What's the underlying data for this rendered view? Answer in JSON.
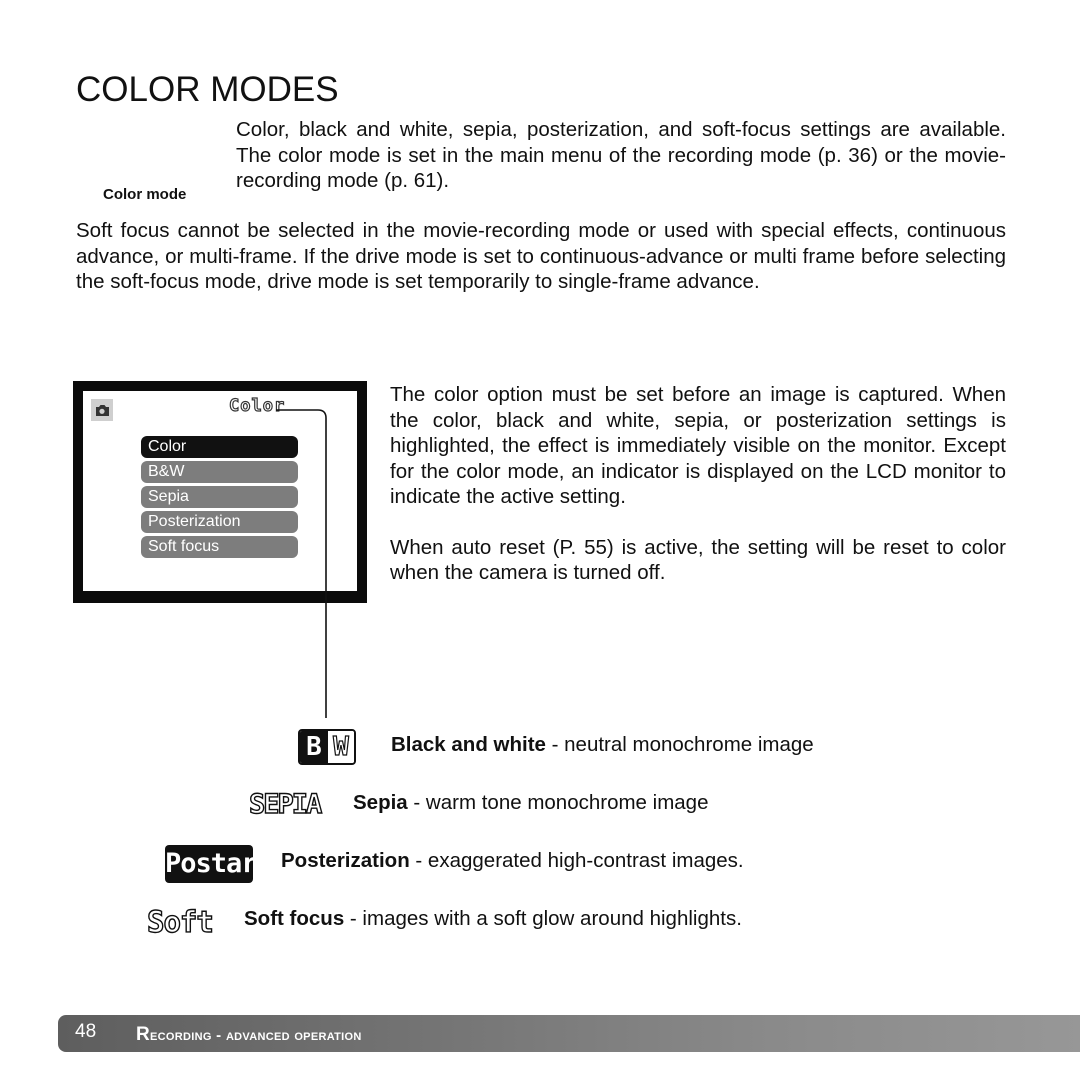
{
  "page": {
    "title": "COLOR MODES",
    "intro": "Color, black and white, sepia, posterization, and soft-focus settings are available. The color mode is set in the main menu of the recording mode (p. 36) or the movie-recording mode (p. 61).",
    "icon_caption": "Color mode",
    "soft_focus_note": "Soft focus cannot be selected in the movie-recording mode or used with special effects, continuous advance, or multi-frame. If the drive mode is set to continuous-advance or multi frame before selecting the soft-focus mode, drive mode is set temporarily to single-frame advance.",
    "right_paragraphs": [
      "The color option must be set before an image is captured. When the color, black and white, sepia, or posterization settings is highlighted, the effect is immediately visible on the monitor. Except for the color mode, an indicator is displayed on the LCD monitor to indicate the active setting.",
      "When auto reset (P. 55) is active, the setting will be reset to color when the camera is turned off."
    ]
  },
  "lcd": {
    "mode_icon": "camera-icon",
    "mode_label": "Color",
    "menu_items": [
      {
        "label": "Color",
        "selected": true
      },
      {
        "label": "B&W",
        "selected": false
      },
      {
        "label": "Sepia",
        "selected": false
      },
      {
        "label": "Posterization",
        "selected": false
      },
      {
        "label": "Soft focus",
        "selected": false
      }
    ]
  },
  "indicators": [
    {
      "badge_left": "B",
      "badge_right": "W",
      "name": "Black and white",
      "description": " - neutral monochrome image"
    },
    {
      "badge": "SEPIA",
      "name": "Sepia",
      "description": " - warm tone monochrome image"
    },
    {
      "badge": "Postar",
      "name": "Posterization",
      "description": " - exaggerated high-contrast images."
    },
    {
      "badge": "Soft",
      "name": "Soft focus",
      "description": " - images with a soft glow around highlights."
    }
  ],
  "footer": {
    "page_number": "48",
    "section_first": "R",
    "section_rest": "ecording - advanced operation"
  },
  "colors": {
    "text": "#111111",
    "menu_selected": "#111111",
    "menu_item": "#7d7d7d",
    "footer_start": "#5e5e5e",
    "footer_end": "#979797"
  }
}
